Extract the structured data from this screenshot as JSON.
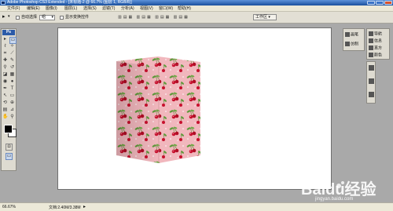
{
  "window": {
    "title": "Adobe Photoshop CS3 Extended - [未标题-2 @ 66.7% (图层 1, RGB/8)]"
  },
  "menu": [
    "文件(F)",
    "编辑(E)",
    "图像(I)",
    "图层(L)",
    "选择(S)",
    "滤镜(T)",
    "分析(A)",
    "视图(V)",
    "窗口(W)",
    "帮助(H)"
  ],
  "options": {
    "auto_select_label": "自动选择",
    "auto_select_value": "组",
    "show_transform_label": "显示变换控件",
    "workspace_label": "工作区 ▾"
  },
  "toolbox": {
    "logo": "Ps"
  },
  "right_panels": {
    "group1": [
      {
        "icon": "brush-icon",
        "label": "画笔"
      },
      {
        "icon": "clone-source-icon",
        "label": "仿制"
      }
    ],
    "group2": [
      {
        "icon": "navigator-icon",
        "label": "导航"
      },
      {
        "icon": "info-icon",
        "label": "信息"
      },
      {
        "icon": "histogram-icon",
        "label": "直方"
      },
      {
        "icon": "color-icon",
        "label": "颜色"
      }
    ],
    "group3": [
      {
        "icon": "layers-icon",
        "label": ""
      },
      {
        "icon": "channels-icon",
        "label": ""
      },
      {
        "icon": "paths-icon",
        "label": ""
      }
    ]
  },
  "status": {
    "zoom": "66.67%",
    "doc": "文档:2.40M/3.38M"
  },
  "watermark": {
    "brand": "Baidu经验",
    "url": "jingyan.baidu.com"
  }
}
